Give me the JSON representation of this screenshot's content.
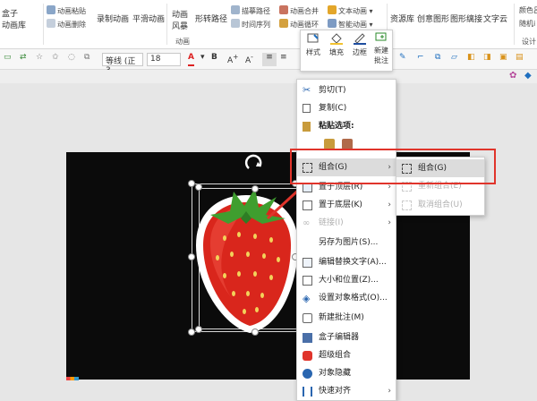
{
  "ribbon": {
    "col1": {
      "line1": "盒子",
      "line2": "动画库"
    },
    "col2": {
      "line1": "动画粘贴",
      "line2": "动画删除"
    },
    "col3": "录制动画",
    "col4": "平滑动画",
    "col5": {
      "line1": "动画",
      "line2": "风暴"
    },
    "col6": "形转路径",
    "col7": {
      "line1": "描摹路径",
      "line2": "时间序列"
    },
    "col8": {
      "line1": "动画合并",
      "line2": "动画循环"
    },
    "col9": {
      "line1": "文本动画",
      "line2": "智能动画"
    },
    "col10": "资源库",
    "col11": "创意图形",
    "col12": "图形缡接",
    "col13": "文字云",
    "col14": {
      "line1": "颜色吕",
      "line2": "随机i"
    },
    "group_anim": "动画",
    "group_design": "设计"
  },
  "format_bar": {
    "font_name": "等线 (正3",
    "font_size": "18",
    "font_color_label": "A",
    "grow_label": "A",
    "shrink_label": "A"
  },
  "float_toolbar": {
    "style": "样式",
    "fill": "填充",
    "border": "边框",
    "new_comment_line1": "新建",
    "new_comment_line2": "批注"
  },
  "context_menu": {
    "items": [
      {
        "label": "剪切(T)",
        "icon": "scissors-icon"
      },
      {
        "label": "复制(C)",
        "icon": "copy-icon"
      },
      {
        "label": "粘贴选项:",
        "icon": "paste-icon"
      },
      {
        "label": "",
        "icon": "paste-format-icons"
      },
      {
        "label": "组合(G)",
        "icon": "group-icon"
      },
      {
        "label": "置于顶层(R)",
        "icon": "bring-front-icon"
      },
      {
        "label": "置于底层(K)",
        "icon": "send-back-icon"
      },
      {
        "label": "链接(I)",
        "icon": "link-icon"
      },
      {
        "label": "另存为图片(S)...",
        "icon": ""
      },
      {
        "label": "编辑替换文字(A)...",
        "icon": "alt-text-icon"
      },
      {
        "label": "大小和位置(Z)...",
        "icon": "size-position-icon"
      },
      {
        "label": "设置对象格式(O)...",
        "icon": "format-object-icon"
      },
      {
        "label": "新建批注(M)",
        "icon": "comment-icon"
      },
      {
        "label": "盒子编辑器",
        "icon": "box-editor-icon"
      },
      {
        "label": "超级组合",
        "icon": "super-group-icon"
      },
      {
        "label": "对象隐藏",
        "icon": "hide-object-icon"
      },
      {
        "label": "快速对齐",
        "icon": "quick-align-icon"
      }
    ]
  },
  "submenu": {
    "items": [
      {
        "label": "组合(G)"
      },
      {
        "label": "重新组合(E)"
      },
      {
        "label": "取消组合(U)"
      }
    ]
  },
  "colors": {
    "highlight": "#e0342b",
    "canvas": "#0b0b0b",
    "accent": "#c0504d"
  }
}
